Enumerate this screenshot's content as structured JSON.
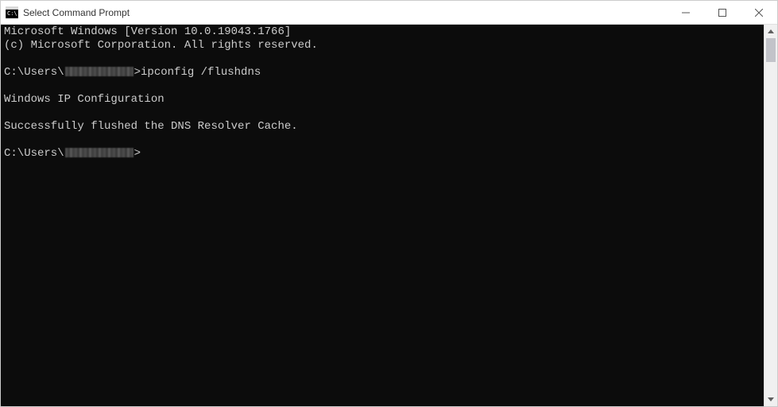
{
  "titlebar": {
    "title": "Select Command Prompt"
  },
  "console": {
    "line1": "Microsoft Windows [Version 10.0.19043.1766]",
    "line2": "(c) Microsoft Corporation. All rights reserved.",
    "prompt1_prefix": "C:\\Users\\",
    "prompt1_suffix": ">",
    "command1": "ipconfig /flushdns",
    "section_header": "Windows IP Configuration",
    "result": "Successfully flushed the DNS Resolver Cache.",
    "prompt2_prefix": "C:\\Users\\",
    "prompt2_suffix": ">"
  }
}
